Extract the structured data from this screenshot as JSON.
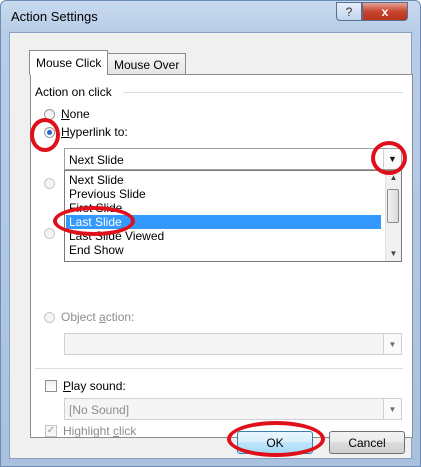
{
  "window": {
    "title": "Action Settings",
    "help_glyph": "?",
    "close_glyph": "x"
  },
  "tabs": [
    {
      "label": "Mouse Click",
      "active": true
    },
    {
      "label": "Mouse Over",
      "active": false
    }
  ],
  "action_group": {
    "label": "Action on click",
    "none": {
      "label_under": "N",
      "label_rest": "one"
    },
    "hyperlink": {
      "label_under": "H",
      "label_rest": "yperlink to:"
    },
    "hyperlink_value": "Next Slide",
    "object_action": {
      "label_pre": "Object ",
      "label_under": "a",
      "label_rest": "ction:"
    }
  },
  "dropdown": {
    "items": [
      {
        "label": "Next Slide",
        "selected": false
      },
      {
        "label": "Previous Slide",
        "selected": false
      },
      {
        "label": "First Slide",
        "selected": false
      },
      {
        "label": "Last Slide",
        "selected": true
      },
      {
        "label": "Last Slide Viewed",
        "selected": false
      },
      {
        "label": "End Show",
        "selected": false
      }
    ]
  },
  "sound": {
    "label_under": "P",
    "label_rest": "lay sound:",
    "value": "[No Sound]"
  },
  "highlight": {
    "label_pre": "Highlight ",
    "label_under": "c",
    "label_rest": "lick",
    "check_glyph": "✓"
  },
  "buttons": {
    "ok": "OK",
    "cancel": "Cancel"
  },
  "icons": {
    "combo_arrow": "▼",
    "scroll_up": "▲",
    "scroll_down": "▼"
  },
  "colors": {
    "annotation": "#e0101a",
    "selection": "#3399ff"
  }
}
